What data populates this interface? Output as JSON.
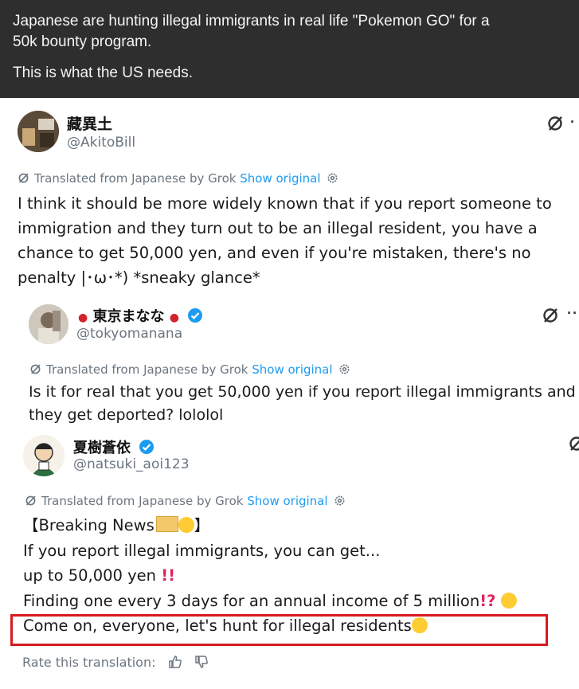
{
  "caption": {
    "line1": "Japanese are hunting illegal immigrants in real life \"Pokemon GO\" for a",
    "line2": "50k bounty program.",
    "line3": "This is what the US needs."
  },
  "posts": [
    {
      "name": "藏異土",
      "handle": "@AkitoBill",
      "translated_prefix": "Translated from Japanese by Grok",
      "show_original": "Show original",
      "lines": [
        "I think it should be more widely known that if you report someone to",
        "immigration and they turn out to be an illegal resident, you have a",
        "chance to get 50,000 yen, and even if you're mistaken, there's no",
        "penalty |･ω･*) *sneaky glance*"
      ]
    },
    {
      "name": "東京まなな",
      "handle": "@tokyomanana",
      "translated_prefix": "Translated from Japanese by Grok",
      "show_original": "Show original",
      "lines": [
        "Is it for real that you get 50,000 yen if you report illegal immigrants and",
        "they get deported? lololol"
      ]
    },
    {
      "name": "夏樹蒼依",
      "handle": "@natsuki_aoi123",
      "translated_prefix": "Translated from Japanese by Grok",
      "show_original": "Show original",
      "lines": [
        "【Breaking News",
        "If you report illegal immigrants, you can get...",
        "up to 50,000 yen",
        "Finding one every 3 days for an annual income of 5 million",
        "Come on, everyone, let's hunt for illegal residents"
      ],
      "close_bracket": "】",
      "exclaim_double": "!!",
      "exclaim_question": "!?"
    }
  ],
  "rate_translation": "Rate this translation:",
  "colors": {
    "header_bg": "#2e2e2e",
    "link": "#1d9bf0",
    "verified": "#1d9bf0",
    "highlight": "#d71920"
  },
  "icons": [
    "grok-icon",
    "more-icon",
    "gear-icon",
    "verified-icon",
    "thumbs-up-icon",
    "thumbs-down-icon",
    "japan-flag-icon"
  ]
}
